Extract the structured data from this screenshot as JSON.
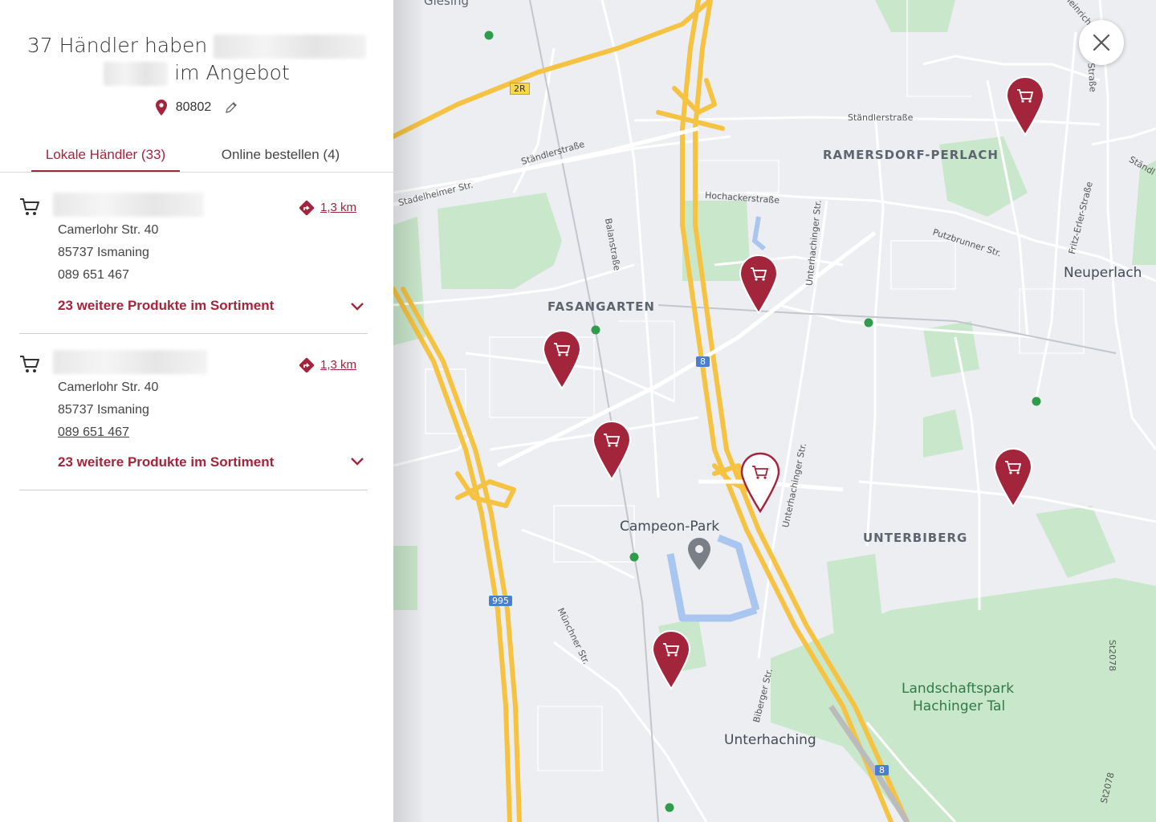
{
  "header": {
    "title_line1": "37 Händler haben",
    "title_line2": "im Angebot",
    "zip": "80802"
  },
  "tabs": [
    {
      "label": "Lokale Händler (33)",
      "active": true
    },
    {
      "label": "Online bestellen (4)",
      "active": false
    }
  ],
  "dealers": [
    {
      "street": "Camerlohr Str. 40",
      "city": "85737 Ismaning",
      "phone": "089 651 467",
      "distance": "1,3 km",
      "more": "23 weitere Produkte im Sortiment"
    },
    {
      "street": "Camerlohr Str. 40",
      "city": "85737 Ismaning",
      "phone": "089 651 467",
      "distance": "1,3 km",
      "more": "23 weitere Produkte im Sortiment"
    }
  ],
  "map": {
    "labels": {
      "giesing": "Giesing",
      "ramersdorf": "RAMERSDORF-PERLACH",
      "fasangarten": "FASANGARTEN",
      "neuperlach": "Neuperlach",
      "unterbiberg": "UNTERBIBERG",
      "campeon": "Campeon-Park",
      "unterhaching": "Unterhaching",
      "landschaftspark1": "Landschaftspark",
      "landschaftspark2": "Hachinger Tal",
      "staendler1": "Ständlerstraße",
      "staendler2": "Ständlerstraße",
      "hochacker": "Hochackerstraße",
      "stadelheimer": "Stadelheimer Str.",
      "balan": "Balanstraße",
      "unterhachinger1": "Unterhachinger Str.",
      "unterhachinger2": "Unterhachinger Str.",
      "putzbrunner": "Putzbrunner Str.",
      "fritzerler": "Fritz-Erler-Straße",
      "muenchner": "Münchner Str.",
      "biberger": "Biberger Str.",
      "st2078a": "St2078",
      "st2078b": "St2078",
      "heinrich": "Heinrich",
      "strasse": "Straße",
      "staendl": "Ständl",
      "shield_2r": "2R",
      "shield_8a": "8",
      "shield_8b": "8",
      "shield_995": "995"
    }
  },
  "colors": {
    "accent": "#a3253b",
    "highway": "#f5c242",
    "park": "#c7e6c8",
    "road": "#ffffff"
  }
}
